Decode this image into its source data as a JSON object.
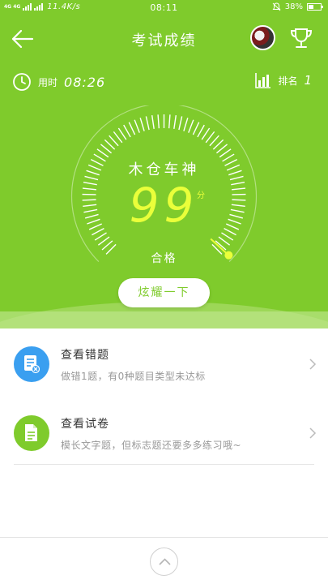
{
  "status_bar": {
    "network": "4G 4G",
    "speed": "11.4K/s",
    "time": "08:11",
    "battery": "38%"
  },
  "nav": {
    "title": "考试成绩",
    "icons": {
      "back": "arrow-left-icon",
      "trophy": "trophy-icon",
      "avatar": "user-avatar"
    }
  },
  "stats": {
    "time_label": "用时",
    "time_value": "08:26",
    "rank_label": "排名",
    "rank_value": "1"
  },
  "result": {
    "user_name": "木仓车神",
    "score": "99",
    "score_unit": "分",
    "score_fraction": 0.99,
    "grade": "合格"
  },
  "show_off_button": "炫耀一下",
  "list": [
    {
      "title": "查看错题",
      "description": "做错1题，有0种题目类型未达标",
      "icon": "wrong-questions-icon",
      "icon_color": "#3a9ff0"
    },
    {
      "title": "查看试卷",
      "description": "模长文字题，但标志题还要多多练习哦~",
      "icon": "exam-paper-icon",
      "icon_color": "#7fcb2c"
    }
  ],
  "colors": {
    "primary": "#7fcb2c",
    "score": "#eaff3a",
    "blue": "#3a9ff0"
  }
}
